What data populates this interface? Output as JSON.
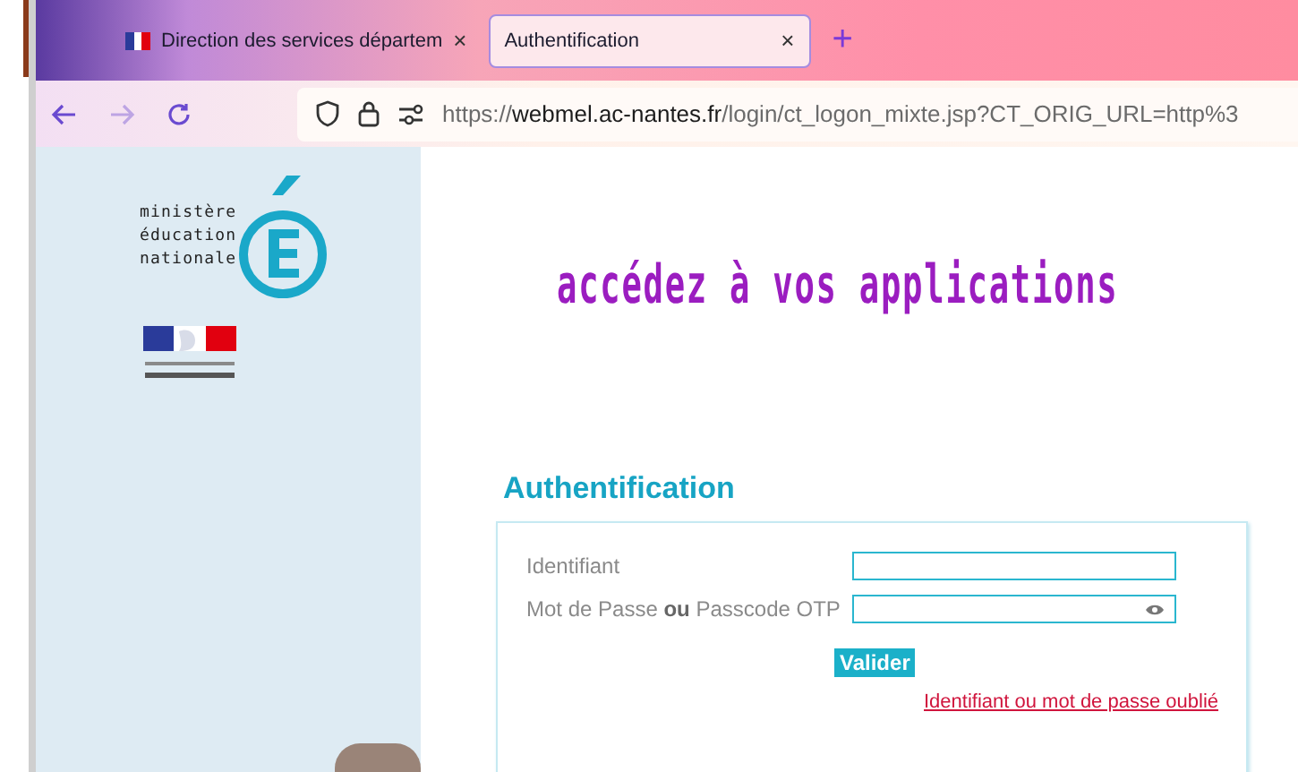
{
  "browser": {
    "tabs": [
      {
        "title": "Direction des services départem",
        "selected": false,
        "kind": "marianne"
      },
      {
        "title": "Authentification",
        "selected": true,
        "kind": "none"
      }
    ],
    "tab_close": "×",
    "new_tab": "+",
    "nav": {
      "back_disabled": false,
      "forward_disabled": true
    },
    "url": {
      "scheme": "https://",
      "host": "webmel.ac-nantes.fr",
      "path": "/login/ct_logon_mixte.jsp?CT_ORIG_URL=http%3"
    }
  },
  "sidebar": {
    "logo_lines": [
      "ministère",
      "éducation",
      "nationale"
    ]
  },
  "banner": "accédez à vos applications",
  "form": {
    "title": "Authentification",
    "fields": [
      {
        "label": "Identifiant",
        "kind": "text"
      },
      {
        "label": "Mot de Passe **ou** Passcode OTP",
        "kind": "password"
      }
    ],
    "submit": "Valider",
    "forgot_link": "Identifiant ou mot de passe oublié"
  }
}
